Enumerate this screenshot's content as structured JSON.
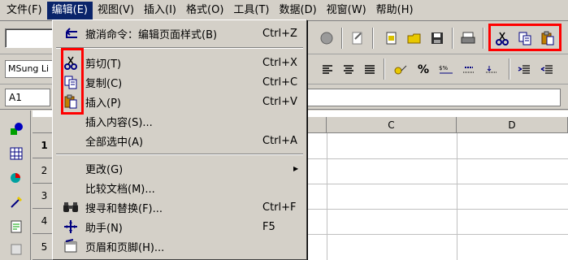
{
  "menubar": {
    "items": [
      {
        "label": "文件(F)",
        "active": false
      },
      {
        "label": "编辑(E)",
        "active": true
      },
      {
        "label": "视图(V)",
        "active": false
      },
      {
        "label": "插入(I)",
        "active": false
      },
      {
        "label": "格式(O)",
        "active": false
      },
      {
        "label": "工具(T)",
        "active": false
      },
      {
        "label": "数据(D)",
        "active": false
      },
      {
        "label": "视窗(W)",
        "active": false
      },
      {
        "label": "帮助(H)",
        "active": false
      }
    ]
  },
  "font": {
    "name": "MSung Li"
  },
  "formula": {
    "cell_ref": "A1",
    "value": ""
  },
  "columns": {
    "c": "C",
    "d": "D"
  },
  "rows": [
    "1",
    "2",
    "3",
    "4",
    "5"
  ],
  "format_toolbar": {
    "percent": "%"
  },
  "edit_menu": {
    "undo": {
      "label": "撤消命令：编辑页面样式(B)",
      "shortcut": "Ctrl+Z",
      "icon": "undo-arrow-icon"
    },
    "cut": {
      "label": "剪切(T)",
      "shortcut": "Ctrl+X",
      "icon": "scissors-icon"
    },
    "copy": {
      "label": "复制(C)",
      "shortcut": "Ctrl+C",
      "icon": "copy-icon"
    },
    "paste": {
      "label": "插入(P)",
      "shortcut": "Ctrl+V",
      "icon": "paste-icon"
    },
    "paste_special": {
      "label": "插入内容(S)..."
    },
    "select_all": {
      "label": "全部选中(A)",
      "shortcut": "Ctrl+A"
    },
    "changes": {
      "label": "更改(G)"
    },
    "compare": {
      "label": "比较文档(M)..."
    },
    "find_replace": {
      "label": "搜寻和替换(F)...",
      "shortcut": "Ctrl+F",
      "icon": "binoculars-icon"
    },
    "navigator": {
      "label": "助手(N)",
      "shortcut": "F5",
      "icon": "navigator-icon"
    },
    "header_footer": {
      "label": "页眉和页脚(H)...",
      "icon": "header-footer-icon"
    }
  },
  "highlight_color": "#ff0000",
  "menu_highlight_color": "#0a246a"
}
